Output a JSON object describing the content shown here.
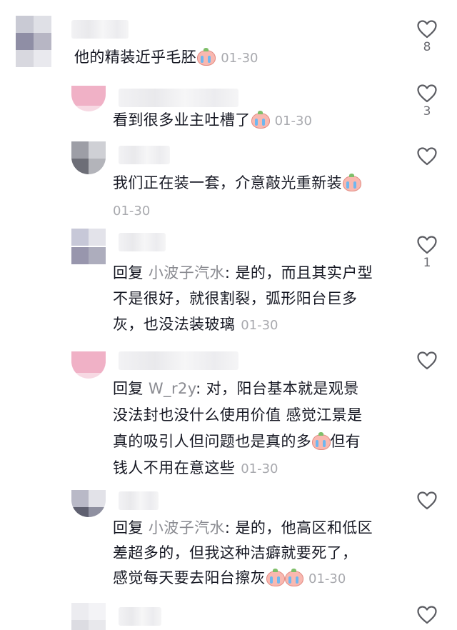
{
  "comments": [
    {
      "text": "他的精装近乎毛胚",
      "time": "01-30",
      "likes": "8",
      "emojis": 1
    },
    {
      "text": "看到很多业主吐槽了",
      "time": "01-30",
      "likes": "3",
      "emojis": 1
    },
    {
      "text": "我们正在装一套，介意敲光重新装",
      "time": "01-30",
      "likes": "",
      "emojis": 1
    },
    {
      "reply_prefix": "回复",
      "reply_to": "小波子汽水",
      "lines": [
        "是的，而且其实户型",
        "不是很好，就很割裂，弧形阳台巨多",
        "灰，也没法装玻璃"
      ],
      "time": "01-30",
      "likes": "1"
    },
    {
      "reply_prefix": "回复",
      "reply_to": "W_r2y",
      "lines": [
        "对，阳台基本就是观景",
        "没法封也没什么使用价值 感觉江景是",
        "真的吸引人但问题也是真的多",
        "但有",
        "钱人不用在意这些"
      ],
      "time": "01-30",
      "likes": ""
    },
    {
      "reply_prefix": "回复",
      "reply_to": "小波子汽水",
      "lines": [
        "是的，他高区和低区",
        "差超多的，但我这种洁癖就要死了，",
        "感觉每天要去阳台擦灰"
      ],
      "time": "01-30",
      "likes": ""
    }
  ],
  "colors": {
    "text": "#161823",
    "secondary": "#a8a9ae",
    "reply_name": "#8a8b91",
    "like_icon": "#5c5d63"
  },
  "icons": {
    "like": "heart-outline-icon",
    "emoji": "crying-peach-emoji-icon"
  }
}
